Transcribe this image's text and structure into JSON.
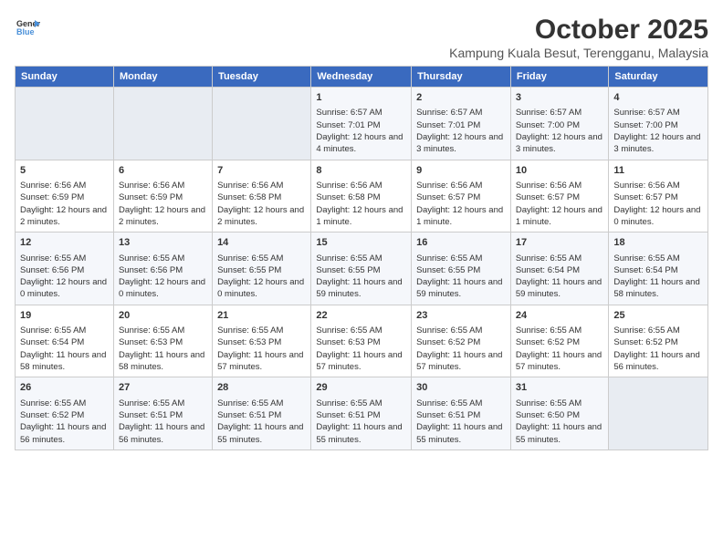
{
  "logo": {
    "line1": "General",
    "line2": "Blue"
  },
  "header": {
    "title": "October 2025",
    "subtitle": "Kampung Kuala Besut, Terengganu, Malaysia"
  },
  "columns": [
    "Sunday",
    "Monday",
    "Tuesday",
    "Wednesday",
    "Thursday",
    "Friday",
    "Saturday"
  ],
  "weeks": [
    [
      {
        "day": "",
        "empty": true
      },
      {
        "day": "",
        "empty": true
      },
      {
        "day": "",
        "empty": true
      },
      {
        "day": "1",
        "sunrise": "Sunrise: 6:57 AM",
        "sunset": "Sunset: 7:01 PM",
        "daylight": "Daylight: 12 hours and 4 minutes."
      },
      {
        "day": "2",
        "sunrise": "Sunrise: 6:57 AM",
        "sunset": "Sunset: 7:01 PM",
        "daylight": "Daylight: 12 hours and 3 minutes."
      },
      {
        "day": "3",
        "sunrise": "Sunrise: 6:57 AM",
        "sunset": "Sunset: 7:00 PM",
        "daylight": "Daylight: 12 hours and 3 minutes."
      },
      {
        "day": "4",
        "sunrise": "Sunrise: 6:57 AM",
        "sunset": "Sunset: 7:00 PM",
        "daylight": "Daylight: 12 hours and 3 minutes."
      }
    ],
    [
      {
        "day": "5",
        "sunrise": "Sunrise: 6:56 AM",
        "sunset": "Sunset: 6:59 PM",
        "daylight": "Daylight: 12 hours and 2 minutes."
      },
      {
        "day": "6",
        "sunrise": "Sunrise: 6:56 AM",
        "sunset": "Sunset: 6:59 PM",
        "daylight": "Daylight: 12 hours and 2 minutes."
      },
      {
        "day": "7",
        "sunrise": "Sunrise: 6:56 AM",
        "sunset": "Sunset: 6:58 PM",
        "daylight": "Daylight: 12 hours and 2 minutes."
      },
      {
        "day": "8",
        "sunrise": "Sunrise: 6:56 AM",
        "sunset": "Sunset: 6:58 PM",
        "daylight": "Daylight: 12 hours and 1 minute."
      },
      {
        "day": "9",
        "sunrise": "Sunrise: 6:56 AM",
        "sunset": "Sunset: 6:57 PM",
        "daylight": "Daylight: 12 hours and 1 minute."
      },
      {
        "day": "10",
        "sunrise": "Sunrise: 6:56 AM",
        "sunset": "Sunset: 6:57 PM",
        "daylight": "Daylight: 12 hours and 1 minute."
      },
      {
        "day": "11",
        "sunrise": "Sunrise: 6:56 AM",
        "sunset": "Sunset: 6:57 PM",
        "daylight": "Daylight: 12 hours and 0 minutes."
      }
    ],
    [
      {
        "day": "12",
        "sunrise": "Sunrise: 6:55 AM",
        "sunset": "Sunset: 6:56 PM",
        "daylight": "Daylight: 12 hours and 0 minutes."
      },
      {
        "day": "13",
        "sunrise": "Sunrise: 6:55 AM",
        "sunset": "Sunset: 6:56 PM",
        "daylight": "Daylight: 12 hours and 0 minutes."
      },
      {
        "day": "14",
        "sunrise": "Sunrise: 6:55 AM",
        "sunset": "Sunset: 6:55 PM",
        "daylight": "Daylight: 12 hours and 0 minutes."
      },
      {
        "day": "15",
        "sunrise": "Sunrise: 6:55 AM",
        "sunset": "Sunset: 6:55 PM",
        "daylight": "Daylight: 11 hours and 59 minutes."
      },
      {
        "day": "16",
        "sunrise": "Sunrise: 6:55 AM",
        "sunset": "Sunset: 6:55 PM",
        "daylight": "Daylight: 11 hours and 59 minutes."
      },
      {
        "day": "17",
        "sunrise": "Sunrise: 6:55 AM",
        "sunset": "Sunset: 6:54 PM",
        "daylight": "Daylight: 11 hours and 59 minutes."
      },
      {
        "day": "18",
        "sunrise": "Sunrise: 6:55 AM",
        "sunset": "Sunset: 6:54 PM",
        "daylight": "Daylight: 11 hours and 58 minutes."
      }
    ],
    [
      {
        "day": "19",
        "sunrise": "Sunrise: 6:55 AM",
        "sunset": "Sunset: 6:54 PM",
        "daylight": "Daylight: 11 hours and 58 minutes."
      },
      {
        "day": "20",
        "sunrise": "Sunrise: 6:55 AM",
        "sunset": "Sunset: 6:53 PM",
        "daylight": "Daylight: 11 hours and 58 minutes."
      },
      {
        "day": "21",
        "sunrise": "Sunrise: 6:55 AM",
        "sunset": "Sunset: 6:53 PM",
        "daylight": "Daylight: 11 hours and 57 minutes."
      },
      {
        "day": "22",
        "sunrise": "Sunrise: 6:55 AM",
        "sunset": "Sunset: 6:53 PM",
        "daylight": "Daylight: 11 hours and 57 minutes."
      },
      {
        "day": "23",
        "sunrise": "Sunrise: 6:55 AM",
        "sunset": "Sunset: 6:52 PM",
        "daylight": "Daylight: 11 hours and 57 minutes."
      },
      {
        "day": "24",
        "sunrise": "Sunrise: 6:55 AM",
        "sunset": "Sunset: 6:52 PM",
        "daylight": "Daylight: 11 hours and 57 minutes."
      },
      {
        "day": "25",
        "sunrise": "Sunrise: 6:55 AM",
        "sunset": "Sunset: 6:52 PM",
        "daylight": "Daylight: 11 hours and 56 minutes."
      }
    ],
    [
      {
        "day": "26",
        "sunrise": "Sunrise: 6:55 AM",
        "sunset": "Sunset: 6:52 PM",
        "daylight": "Daylight: 11 hours and 56 minutes."
      },
      {
        "day": "27",
        "sunrise": "Sunrise: 6:55 AM",
        "sunset": "Sunset: 6:51 PM",
        "daylight": "Daylight: 11 hours and 56 minutes."
      },
      {
        "day": "28",
        "sunrise": "Sunrise: 6:55 AM",
        "sunset": "Sunset: 6:51 PM",
        "daylight": "Daylight: 11 hours and 55 minutes."
      },
      {
        "day": "29",
        "sunrise": "Sunrise: 6:55 AM",
        "sunset": "Sunset: 6:51 PM",
        "daylight": "Daylight: 11 hours and 55 minutes."
      },
      {
        "day": "30",
        "sunrise": "Sunrise: 6:55 AM",
        "sunset": "Sunset: 6:51 PM",
        "daylight": "Daylight: 11 hours and 55 minutes."
      },
      {
        "day": "31",
        "sunrise": "Sunrise: 6:55 AM",
        "sunset": "Sunset: 6:50 PM",
        "daylight": "Daylight: 11 hours and 55 minutes."
      },
      {
        "day": "",
        "empty": true
      }
    ]
  ]
}
